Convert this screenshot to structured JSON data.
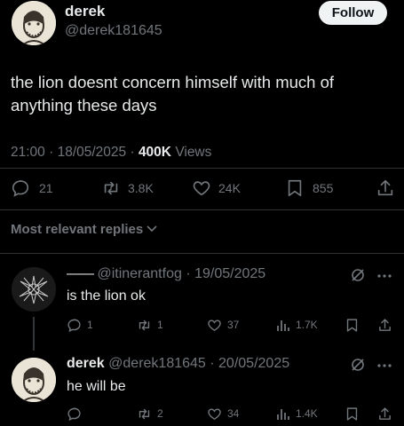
{
  "tweet": {
    "name": "derek",
    "handle": "@derek181645",
    "follow_label": "Follow",
    "text_line1": "the lion doesnt concern himself with much of",
    "text_line2": "anything these days",
    "time": "21:00",
    "date": "18/05/2025",
    "views_count": "400K",
    "views_label": "Views",
    "replies": "21",
    "reposts": "3.8K",
    "likes": "24K",
    "bookmarks": "855"
  },
  "sort": {
    "label": "Most relevant replies"
  },
  "replies": [
    {
      "prefix": "——",
      "handle": "@itinerantfog",
      "date": "19/05/2025",
      "text": "is the lion ok",
      "replies": "1",
      "reposts": "1",
      "likes": "37",
      "views": "1.7K"
    },
    {
      "name": "derek",
      "handle": "@derek181645",
      "date": "20/05/2025",
      "text": "he will be",
      "replies": "",
      "reposts": "2",
      "likes": "34",
      "views": "1.4K"
    }
  ],
  "colors": {
    "background": "#000000",
    "text": "#e7e9ea",
    "muted": "#71767b",
    "divider": "#2f3336"
  },
  "icons": [
    "reply-icon",
    "repost-icon",
    "like-icon",
    "bookmark-icon",
    "share-icon",
    "views-icon",
    "grok-icon",
    "more-icon",
    "chevron-down-icon"
  ]
}
